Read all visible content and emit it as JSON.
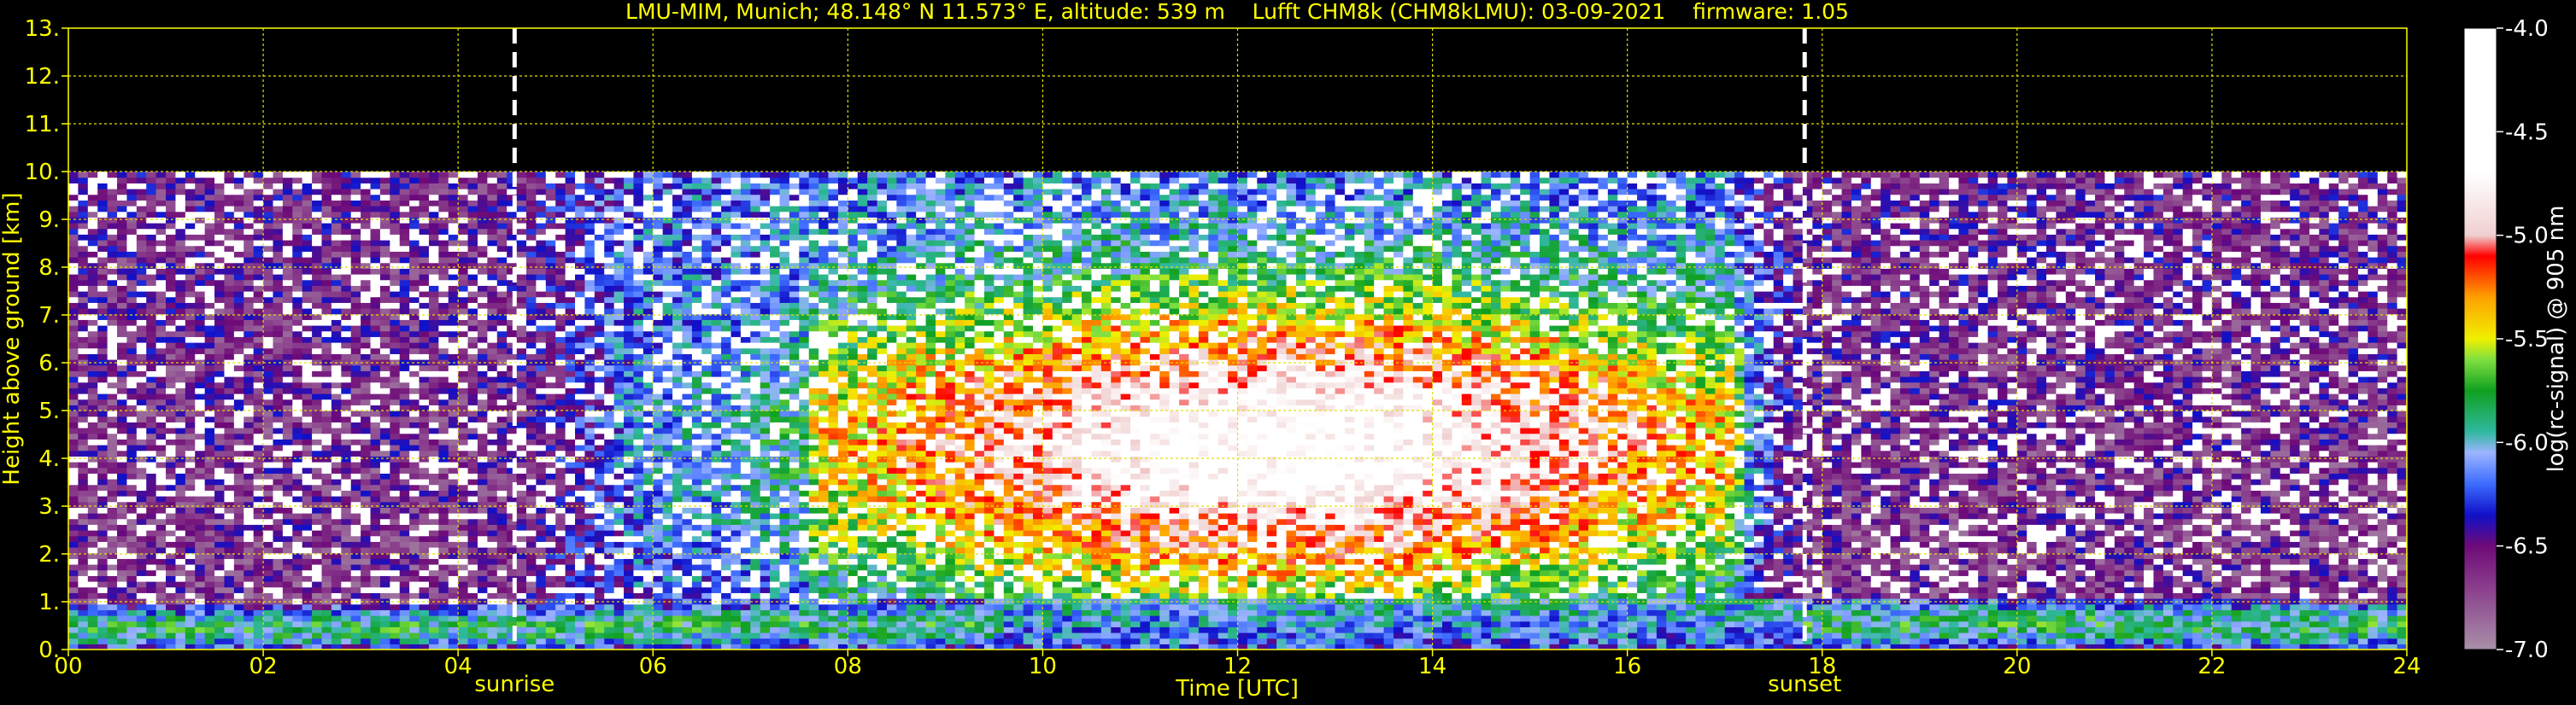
{
  "chart_data": {
    "type": "heatmap",
    "title": "LMU-MIM, Munich; 48.148° N 11.573° E, altitude: 539 m    Lufft CHM8k (CHM8kLMU): 03-09-2021    firmware: 1.05",
    "xlabel": "Time [UTC]",
    "ylabel": "Height above ground [km]",
    "xlim": [
      0,
      24
    ],
    "ylim": [
      0,
      13
    ],
    "x_ticks": [
      0,
      2,
      4,
      6,
      8,
      10,
      12,
      14,
      16,
      18,
      20,
      22,
      24
    ],
    "x_tick_labels": [
      "00",
      "02",
      "04",
      "06",
      "08",
      "10",
      "12",
      "14",
      "16",
      "18",
      "20",
      "22",
      "24"
    ],
    "y_ticks": [
      0,
      1,
      2,
      3,
      4,
      5,
      6,
      7,
      8,
      9,
      10,
      11,
      12,
      13
    ],
    "y_tick_labels": [
      "0.",
      "1.",
      "2.",
      "3.",
      "4.",
      "5.",
      "6.",
      "7.",
      "8.",
      "9.",
      "10.",
      "11.",
      "12.",
      "13."
    ],
    "grid": true,
    "data_top_km": 10,
    "markers": [
      {
        "label": "sunrise",
        "x": 4.58
      },
      {
        "label": "sunset",
        "x": 17.82
      }
    ],
    "boundary_layer_top_km": [
      {
        "x": 0,
        "y": 0.9
      },
      {
        "x": 2,
        "y": 0.9
      },
      {
        "x": 4,
        "y": 0.95
      },
      {
        "x": 6,
        "y": 1.0
      },
      {
        "x": 8,
        "y": 1.0
      },
      {
        "x": 9.6,
        "y": 1.1
      },
      {
        "x": 12,
        "y": 1.1
      },
      {
        "x": 16,
        "y": 1.1
      },
      {
        "x": 17.8,
        "y": 1.1
      },
      {
        "x": 20,
        "y": 1.05
      },
      {
        "x": 24,
        "y": 1.0
      }
    ],
    "colorbar": {
      "label": "log(rc-signal) @ 905 nm",
      "min": -7.0,
      "max": -4.0,
      "ticks": [
        -4.0,
        -4.5,
        -5.0,
        -5.5,
        -6.0,
        -6.5,
        -7.0
      ],
      "tick_labels": [
        "-4.0",
        "-4.5",
        "-5.0",
        "-5.5",
        "-6.0",
        "-6.5",
        "-7.0"
      ],
      "stops": [
        {
          "v": -7.0,
          "color": "#a890a8"
        },
        {
          "v": -6.7,
          "color": "#8a3e8c"
        },
        {
          "v": -6.5,
          "color": "#6e0a78"
        },
        {
          "v": -6.35,
          "color": "#1010c8"
        },
        {
          "v": -6.2,
          "color": "#3c6cff"
        },
        {
          "v": -6.05,
          "color": "#9cb4ff"
        },
        {
          "v": -5.95,
          "color": "#30b8a0"
        },
        {
          "v": -5.75,
          "color": "#10a020"
        },
        {
          "v": -5.6,
          "color": "#80e040"
        },
        {
          "v": -5.5,
          "color": "#f0f000"
        },
        {
          "v": -5.3,
          "color": "#ffa000"
        },
        {
          "v": -5.1,
          "color": "#ff0000"
        },
        {
          "v": -5.0,
          "color": "#f0d0d0"
        },
        {
          "v": -4.7,
          "color": "#ffffff"
        },
        {
          "v": -4.0,
          "color": "#ffffff"
        }
      ]
    }
  },
  "colors": {
    "text": "#ffff00",
    "grid": "#e0e000",
    "background": "#000000",
    "marker_line": "#ffffff"
  }
}
